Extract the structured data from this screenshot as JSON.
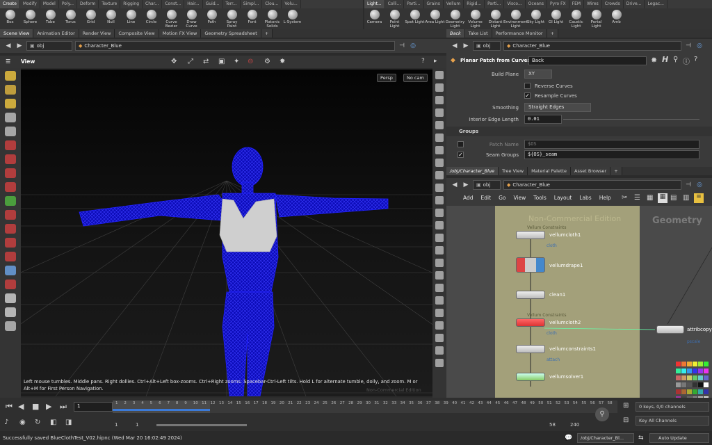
{
  "shelf_left": {
    "tabs": [
      "Create",
      "Modify",
      "Model",
      "Poly...",
      "Deform",
      "Texture",
      "Rigging",
      "Char...",
      "Const...",
      "Hair...",
      "Guid...",
      "Terr...",
      "Simpl...",
      "Clou...",
      "Volu..."
    ],
    "tools": [
      "Box",
      "Sphere",
      "Tube",
      "Torus",
      "Grid",
      "Null",
      "Line",
      "Circle",
      "Curve Bezier",
      "Draw Curve",
      "Path",
      "Spray Paint",
      "Font",
      "Platonic Solids",
      "L-System"
    ]
  },
  "shelf_right": {
    "tabs": [
      "Light...",
      "Colli...",
      "Parti...",
      "Grains",
      "Vellum",
      "Rigid...",
      "Parti...",
      "Visco...",
      "Oceans",
      "Pyro FX",
      "FEM",
      "Wires",
      "Crowds",
      "Drive...",
      "Legac..."
    ],
    "tools": [
      "Camera",
      "Point Light",
      "Spot Light",
      "Area Light",
      "Geometry Light",
      "Volume Light",
      "Distant Light",
      "Environment Light",
      "Sky Light",
      "GI Light",
      "Caustic Light",
      "Portal Light",
      "Amb"
    ]
  },
  "viewer_tabs": [
    "Scene View",
    "Animation Editor",
    "Render View",
    "Composite View",
    "Motion FX View",
    "Geometry Spreadsheet"
  ],
  "viewer_path": {
    "obj": "obj",
    "node": "Character_Blue"
  },
  "viewport": {
    "title": "View",
    "persp": "Persp",
    "cam": "No cam",
    "help": "Left mouse tumbles. Middle pans. Right dollies. Ctrl+Alt+Left box-zooms. Ctrl+Right zooms. Spacebar-Ctrl-Left tilts. Hold L for alternate tumble, dolly, and zoom.    M or Alt+M for First Person Navigation.",
    "watermark": "Non-Commercial Edition"
  },
  "param_tabs": [
    "Back",
    "Take List",
    "Performance Monitor"
  ],
  "param_path": {
    "obj": "obj",
    "node": "Character_Blue"
  },
  "params": {
    "node_type": "Planar Patch from Curves",
    "node_name": "Back",
    "build_plane_label": "Build Plane",
    "build_plane": "XY",
    "reverse_curves": "Reverse Curves",
    "resample_curves": "Resample Curves",
    "smoothing_label": "Smoothing",
    "smoothing": "Straight Edges",
    "interior_edge_label": "Interior Edge Length",
    "interior_edge": "0.01",
    "groups_header": "Groups",
    "patch_name_label": "Patch Name",
    "patch_name": "$OS",
    "seam_groups_label": "Seam Groups",
    "seam_groups": "${OS}_seam"
  },
  "network_tabs": [
    "/obj/Character_Blue",
    "Tree View",
    "Material Palette",
    "Asset Browser"
  ],
  "network_path": {
    "obj": "obj",
    "node": "Character_Blue"
  },
  "network_menu": [
    "Add",
    "Edit",
    "Go",
    "View",
    "Tools",
    "Layout",
    "Labs",
    "Help"
  ],
  "network": {
    "watermark": "Non-Commercial Edition",
    "context": "Geometry",
    "nodes": [
      {
        "group": "Vellum Constraints",
        "name": "vellumcloth1",
        "cook": "cloth"
      },
      {
        "group": "",
        "name": "vellumdrape1",
        "cook": ""
      },
      {
        "group": "",
        "name": "clean1",
        "cook": ""
      },
      {
        "group": "Vellum Constraints",
        "name": "vellumcloth2",
        "cook": "cloth"
      },
      {
        "group": "",
        "name": "vellumconstraints1",
        "cook": "attach"
      },
      {
        "group": "",
        "name": "vellumsolver1",
        "cook": ""
      }
    ],
    "side_node": {
      "name": "attribcopy",
      "cook": "pscale"
    }
  },
  "timeline": {
    "frame": "1",
    "ticks": [
      "1",
      "2",
      "3",
      "4",
      "5",
      "6",
      "7",
      "8",
      "9",
      "10",
      "11",
      "12",
      "13",
      "14",
      "15",
      "16",
      "17",
      "18",
      "19",
      "20",
      "21",
      "22",
      "23",
      "24",
      "25",
      "26",
      "27",
      "28",
      "29",
      "30",
      "31",
      "32",
      "33",
      "34",
      "35",
      "36",
      "37",
      "38",
      "39",
      "40",
      "41",
      "42",
      "43",
      "44",
      "45",
      "46",
      "47",
      "48",
      "49",
      "50",
      "51",
      "52",
      "53",
      "54",
      "55",
      "56",
      "57",
      "58"
    ],
    "range_start": "1",
    "range_start2": "1",
    "range_end": "58",
    "range_end2": "240",
    "keys": "0 keys, 0/0 channels",
    "key_all": "Key All Channels"
  },
  "status": {
    "message": "Successfully saved BlueClothTest_V02.hipnc (Wed Mar 20 16:02:49 2024)",
    "path": "/obj/Character_Bl...",
    "update": "Auto Update"
  },
  "colors": {
    "accent": "#f0a020",
    "wire": "#1a1aff",
    "net_bg": "#a3a07a"
  }
}
